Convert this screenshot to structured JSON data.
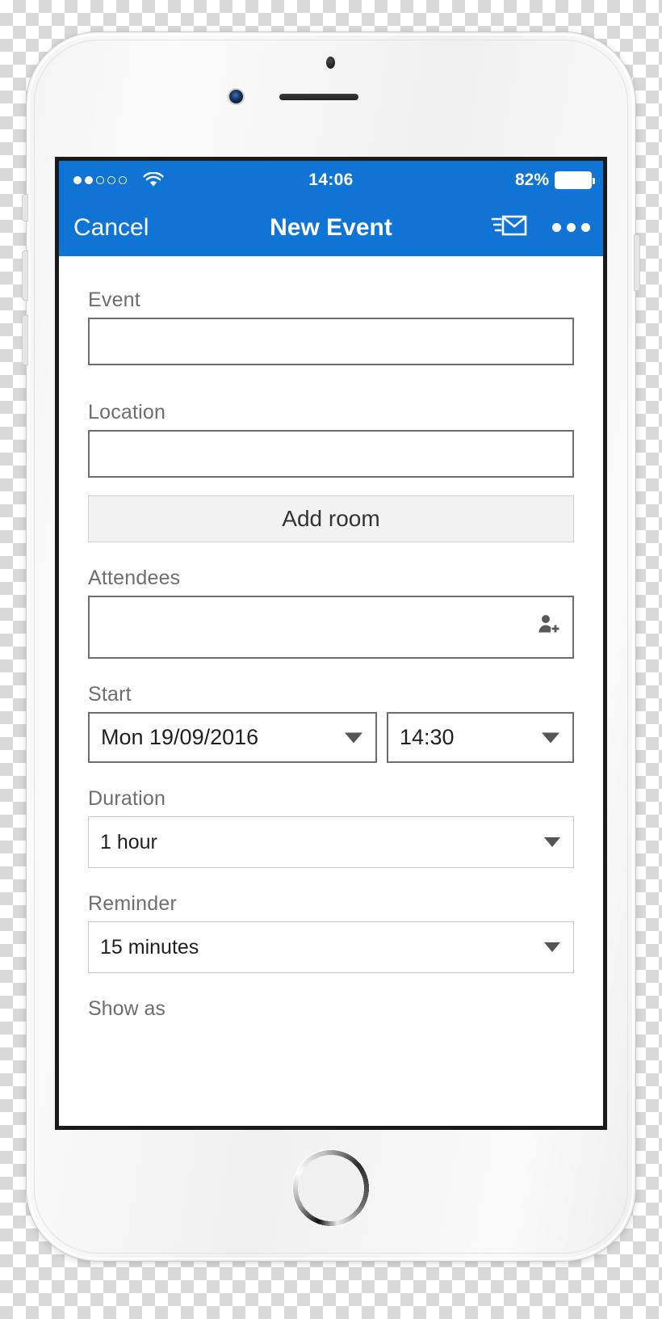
{
  "device": {
    "name": "iphone-white",
    "hardware": {
      "camera": "camera-icon",
      "sensor": "proximity-sensor-icon",
      "speaker": "earpiece-speaker",
      "home_button": "home-button"
    }
  },
  "status_bar": {
    "signal_dots_filled": 2,
    "signal_dots_total": 5,
    "wifi_icon": "wifi-icon",
    "time": "14:06",
    "battery_percent": "82%",
    "battery_icon": "battery-icon",
    "background_color": "#0f74d4"
  },
  "nav_bar": {
    "cancel_label": "Cancel",
    "title": "New Event",
    "send_icon": "send-mail-icon",
    "more_icon": "more-options-icon",
    "background_color": "#0f74d4",
    "text_color": "#ffffff"
  },
  "form": {
    "event": {
      "label": "Event",
      "value": "",
      "placeholder": ""
    },
    "location": {
      "label": "Location",
      "value": "",
      "placeholder": ""
    },
    "add_room": {
      "label": "Add room"
    },
    "attendees": {
      "label": "Attendees",
      "value": "",
      "placeholder": "",
      "icon": "add-person-icon"
    },
    "start": {
      "label": "Start",
      "date_value": "Mon 19/09/2016",
      "time_value": "14:30",
      "date_caret_icon": "chevron-down-icon",
      "time_caret_icon": "chevron-down-icon"
    },
    "duration": {
      "label": "Duration",
      "value": "1 hour",
      "caret_icon": "chevron-down-icon"
    },
    "reminder": {
      "label": "Reminder",
      "value": "15 minutes",
      "caret_icon": "chevron-down-icon"
    },
    "show_as": {
      "label": "Show as"
    }
  },
  "colors": {
    "accent": "#0f74d4",
    "label_gray": "#6e6e6e",
    "input_border": "#6d6d6d",
    "select_border": "#c9c9c9",
    "button_fill": "#f2f2f2"
  }
}
